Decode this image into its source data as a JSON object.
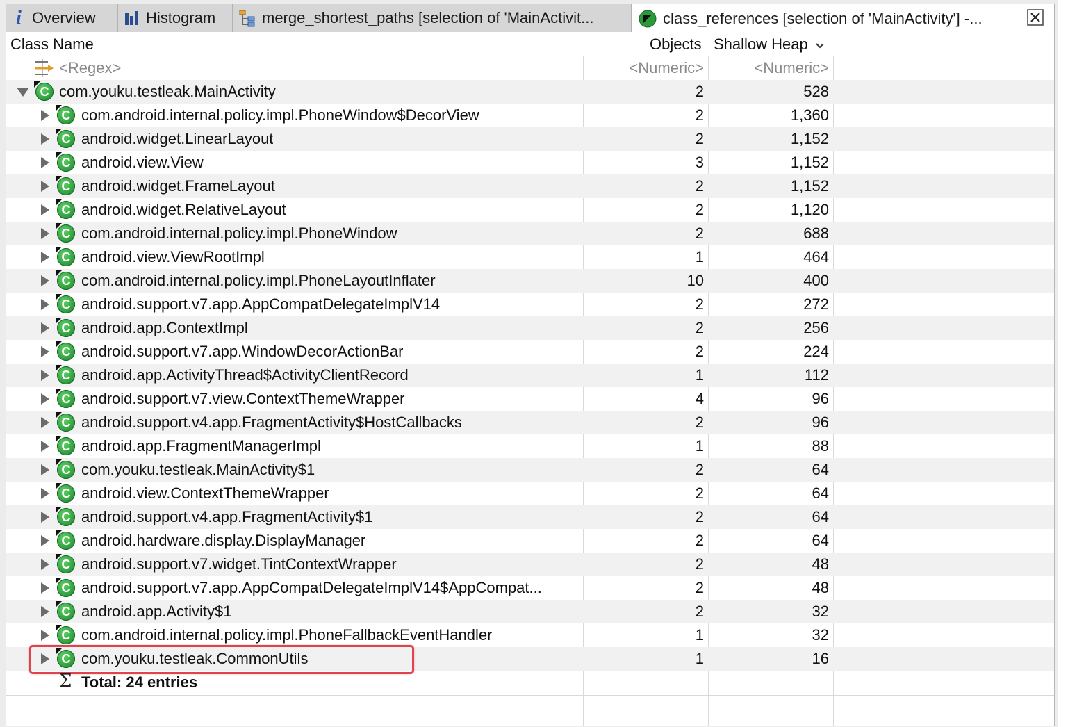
{
  "tabs": [
    {
      "label": "Overview",
      "icon": "info-icon"
    },
    {
      "label": "Histogram",
      "icon": "histogram-icon"
    },
    {
      "label": "merge_shortest_paths [selection of 'MainActivit...",
      "icon": "tree-icon"
    },
    {
      "label": "class_references [selection of 'MainActivity'] -...",
      "icon": "class-references-icon",
      "active": true
    }
  ],
  "columns": {
    "class_name": "Class Name",
    "objects": "Objects",
    "shallow_heap": "Shallow Heap"
  },
  "filters": {
    "regex": "<Regex>",
    "objects": "<Numeric>",
    "shallow_heap": "<Numeric>"
  },
  "root": {
    "name": "com.youku.testleak.MainActivity",
    "objects": "2",
    "shallow_heap": "528"
  },
  "rows": [
    {
      "name": "com.android.internal.policy.impl.PhoneWindow$DecorView",
      "objects": "2",
      "shallow_heap": "1,360"
    },
    {
      "name": "android.widget.LinearLayout",
      "objects": "2",
      "shallow_heap": "1,152"
    },
    {
      "name": "android.view.View",
      "objects": "3",
      "shallow_heap": "1,152"
    },
    {
      "name": "android.widget.FrameLayout",
      "objects": "2",
      "shallow_heap": "1,152"
    },
    {
      "name": "android.widget.RelativeLayout",
      "objects": "2",
      "shallow_heap": "1,120"
    },
    {
      "name": "com.android.internal.policy.impl.PhoneWindow",
      "objects": "2",
      "shallow_heap": "688"
    },
    {
      "name": "android.view.ViewRootImpl",
      "objects": "1",
      "shallow_heap": "464"
    },
    {
      "name": "com.android.internal.policy.impl.PhoneLayoutInflater",
      "objects": "10",
      "shallow_heap": "400"
    },
    {
      "name": "android.support.v7.app.AppCompatDelegateImplV14",
      "objects": "2",
      "shallow_heap": "272"
    },
    {
      "name": "android.app.ContextImpl",
      "objects": "2",
      "shallow_heap": "256"
    },
    {
      "name": "android.support.v7.app.WindowDecorActionBar",
      "objects": "2",
      "shallow_heap": "224"
    },
    {
      "name": "android.app.ActivityThread$ActivityClientRecord",
      "objects": "1",
      "shallow_heap": "112"
    },
    {
      "name": "android.support.v7.view.ContextThemeWrapper",
      "objects": "4",
      "shallow_heap": "96"
    },
    {
      "name": "android.support.v4.app.FragmentActivity$HostCallbacks",
      "objects": "2",
      "shallow_heap": "96"
    },
    {
      "name": "android.app.FragmentManagerImpl",
      "objects": "1",
      "shallow_heap": "88"
    },
    {
      "name": "com.youku.testleak.MainActivity$1",
      "objects": "2",
      "shallow_heap": "64"
    },
    {
      "name": "android.view.ContextThemeWrapper",
      "objects": "2",
      "shallow_heap": "64"
    },
    {
      "name": "android.support.v4.app.FragmentActivity$1",
      "objects": "2",
      "shallow_heap": "64"
    },
    {
      "name": "android.hardware.display.DisplayManager",
      "objects": "2",
      "shallow_heap": "64"
    },
    {
      "name": "android.support.v7.widget.TintContextWrapper",
      "objects": "2",
      "shallow_heap": "48"
    },
    {
      "name": "android.support.v7.app.AppCompatDelegateImplV14$AppCompat...",
      "objects": "2",
      "shallow_heap": "48"
    },
    {
      "name": "android.app.Activity$1",
      "objects": "2",
      "shallow_heap": "32"
    },
    {
      "name": "com.android.internal.policy.impl.PhoneFallbackEventHandler",
      "objects": "1",
      "shallow_heap": "32"
    },
    {
      "name": "com.youku.testleak.CommonUtils",
      "objects": "1",
      "shallow_heap": "16",
      "highlighted": true
    }
  ],
  "total": "Total: 24 entries",
  "colors": {
    "highlight": "#e0424e",
    "class_icon": "#2c9a3a",
    "tab_info": "#2a55b5"
  }
}
